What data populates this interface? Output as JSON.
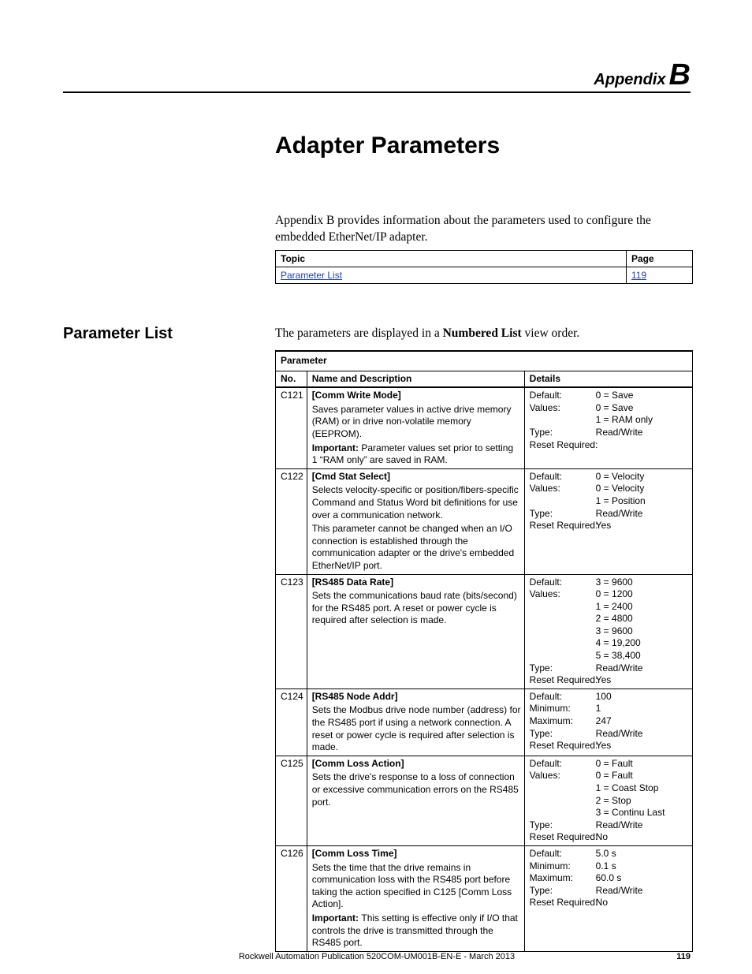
{
  "header": {
    "appendix_word": "Appendix",
    "appendix_letter": "B"
  },
  "chapter_title": "Adapter Parameters",
  "intro": "Appendix B provides information about the parameters used to configure the embedded EtherNet/IP adapter.",
  "topic_table": {
    "headers": {
      "topic": "Topic",
      "page": "Page"
    },
    "rows": [
      {
        "topic": "Parameter List",
        "page": "119"
      }
    ]
  },
  "section": {
    "heading": "Parameter List",
    "intro_pre": "The parameters are displayed in a ",
    "intro_bold": "Numbered List",
    "intro_post": " view order."
  },
  "param_table": {
    "group_header": "Parameter",
    "col_headers": {
      "no": "No.",
      "name": "Name and Description",
      "details": "Details"
    },
    "rows": [
      {
        "no": "C121",
        "name": "[Comm Write Mode]",
        "desc": "Saves parameter values in active drive memory (RAM) or in drive non-volatile memory (EEPROM).",
        "important": "Parameter values set prior to setting 1 “RAM only” are saved in RAM.",
        "details": [
          {
            "k": "Default:",
            "v": "0 = Save"
          },
          {
            "k": "Values:",
            "v": "0 = Save"
          },
          {
            "k": "",
            "v": "1 = RAM only"
          },
          {
            "k": "Type:",
            "v": "Read/Write"
          },
          {
            "k": "Reset Required:",
            "v": ""
          }
        ]
      },
      {
        "no": "C122",
        "name": "[Cmd Stat Select]",
        "desc": "Selects velocity-specific or position/fibers-specific Command and Status Word bit definitions for use over a communication network.",
        "desc2": "This parameter cannot be changed when an I/O connection is established through the communication adapter or the drive's embedded EtherNet/IP port.",
        "details": [
          {
            "k": "Default:",
            "v": "0 = Velocity"
          },
          {
            "k": "Values:",
            "v": "0 = Velocity"
          },
          {
            "k": "",
            "v": "1 = Position"
          },
          {
            "k": "Type:",
            "v": "Read/Write"
          },
          {
            "k": "Reset Required:",
            "v": "Yes"
          }
        ]
      },
      {
        "no": "C123",
        "name": "[RS485 Data Rate]",
        "desc": "Sets the communications baud rate (bits/second) for the RS485 port. A reset or power cycle is required after selection is made.",
        "details": [
          {
            "k": "Default:",
            "v": "3 = 9600"
          },
          {
            "k": "Values:",
            "v": "0 = 1200"
          },
          {
            "k": "",
            "v": "1 = 2400"
          },
          {
            "k": "",
            "v": "2 = 4800"
          },
          {
            "k": "",
            "v": "3 = 9600"
          },
          {
            "k": "",
            "v": "4 = 19,200"
          },
          {
            "k": "",
            "v": "5 = 38,400"
          },
          {
            "k": "Type:",
            "v": "Read/Write"
          },
          {
            "k": "Reset Required:",
            "v": "Yes"
          }
        ]
      },
      {
        "no": "C124",
        "name": "[RS485 Node Addr]",
        "desc": "Sets the Modbus drive node number (address) for the RS485 port if using a network connection. A reset or power cycle is required after selection is made.",
        "details": [
          {
            "k": "Default:",
            "v": "100"
          },
          {
            "k": "Minimum:",
            "v": "1"
          },
          {
            "k": "Maximum:",
            "v": "247"
          },
          {
            "k": "Type:",
            "v": "Read/Write"
          },
          {
            "k": "Reset Required:",
            "v": "Yes"
          }
        ]
      },
      {
        "no": "C125",
        "name": "[Comm Loss Action]",
        "desc": "Sets the drive's response to a loss of connection or excessive communication errors on the RS485 port.",
        "details": [
          {
            "k": "Default:",
            "v": "0 = Fault"
          },
          {
            "k": "Values:",
            "v": "0 = Fault"
          },
          {
            "k": "",
            "v": "1 = Coast Stop"
          },
          {
            "k": "",
            "v": "2 = Stop"
          },
          {
            "k": "",
            "v": "3 = Continu Last"
          },
          {
            "k": "Type:",
            "v": "Read/Write"
          },
          {
            "k": "Reset Required:",
            "v": "No"
          }
        ]
      },
      {
        "no": "C126",
        "name": "[Comm Loss Time]",
        "desc": "Sets the time that the drive remains in communication loss with the RS485 port before taking the action specified in C125 [Comm Loss Action].",
        "important": "This setting is effective only if I/O that controls the drive is transmitted through the RS485 port.",
        "details": [
          {
            "k": "Default:",
            "v": "5.0 s"
          },
          {
            "k": "Minimum:",
            "v": "0.1 s"
          },
          {
            "k": "Maximum:",
            "v": "60.0 s"
          },
          {
            "k": "Type:",
            "v": "Read/Write"
          },
          {
            "k": "Reset Required:",
            "v": "No"
          }
        ]
      }
    ]
  },
  "footer": {
    "publication": "Rockwell Automation Publication 520COM-UM001B-EN-E - March 2013",
    "page_number": "119"
  },
  "labels": {
    "important": "Important:"
  }
}
